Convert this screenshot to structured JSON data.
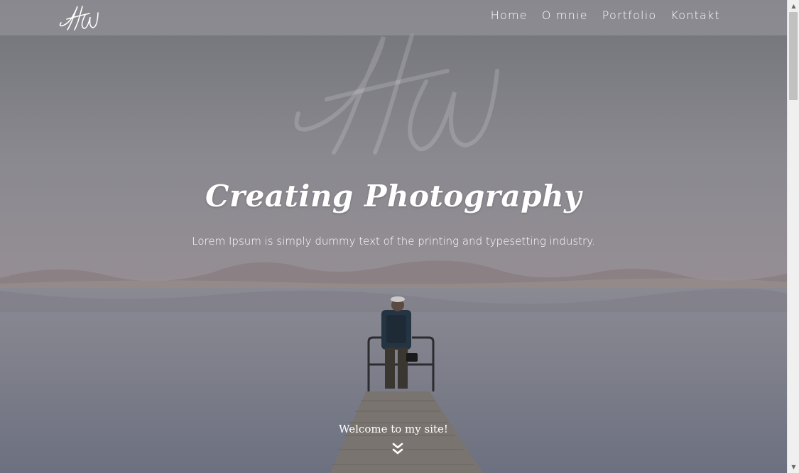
{
  "nav": {
    "logo_text": "HW",
    "links": [
      {
        "label": "Home"
      },
      {
        "label": "O mnie"
      },
      {
        "label": "Portfolio"
      },
      {
        "label": "Kontakt"
      }
    ]
  },
  "hero": {
    "watermark_text": "HW",
    "title": "Creating Photography",
    "subtitle": "Lorem Ipsum is simply dummy text of the printing and typesetting industry.",
    "welcome": "Welcome to my site!"
  },
  "icons": {
    "scroll_down": "double-chevron-down-icon",
    "scrollbar_up": "triangle-up-icon",
    "scrollbar_down": "triangle-down-icon"
  },
  "colors": {
    "overlay_nav": "#9b9ba0",
    "text": "#ffffff"
  }
}
